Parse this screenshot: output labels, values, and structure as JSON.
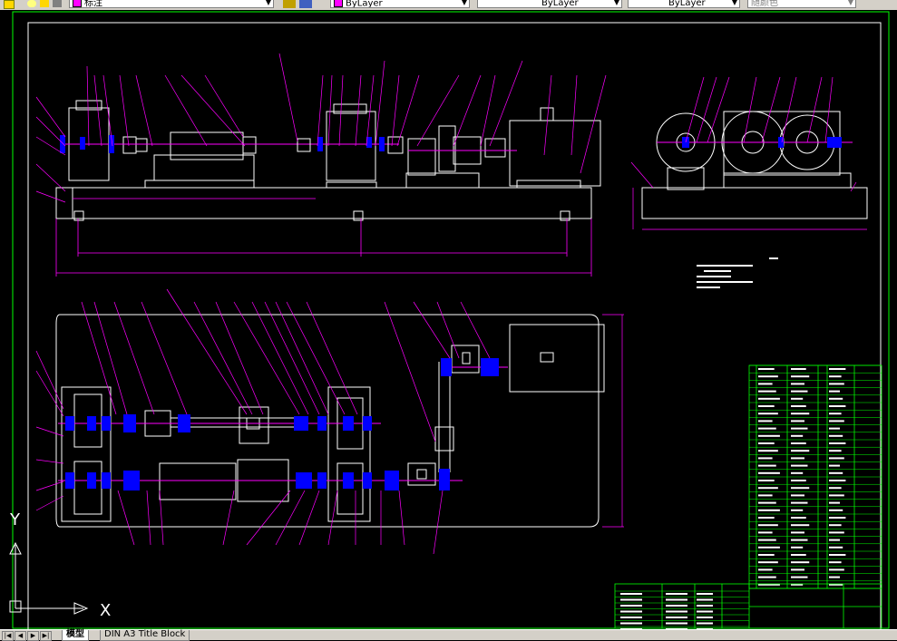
{
  "toolbar": {
    "style_combo": "标注",
    "layer_combo": "ByLayer",
    "linetype_combo": "ByLayer",
    "lineweight_combo": "ByLayer",
    "plotstyle_combo": "随颜色"
  },
  "ucs": {
    "x_label": "X",
    "y_label": "Y"
  },
  "layout_tabs": {
    "model": "模型",
    "layout1": "DIN A3 Title Block"
  },
  "colors": {
    "background": "#000000",
    "frame": "#ffffff",
    "magenta": "#ff00ff",
    "blue": "#0000ff",
    "green": "#00ff00",
    "yellow": "#ffff00",
    "cyan": "#00ffff"
  }
}
